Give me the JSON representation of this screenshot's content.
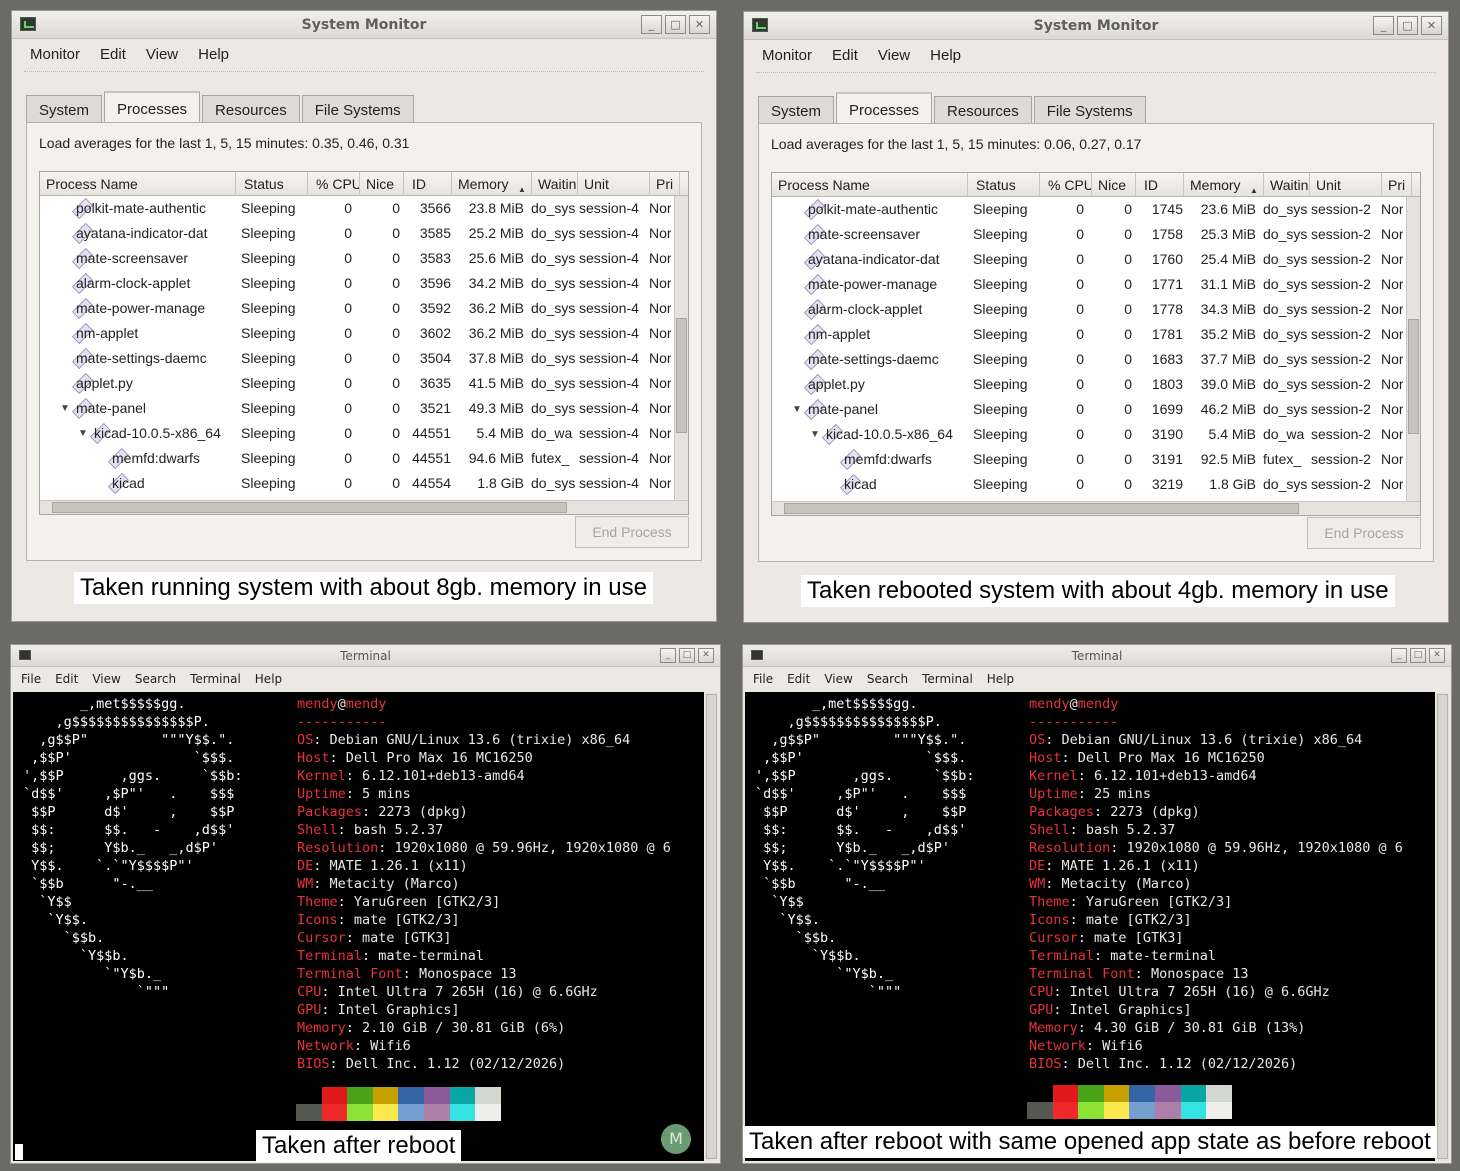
{
  "colors": {
    "key": "#e5333a",
    "frame": "#6a6a66"
  },
  "panels": [
    {
      "title": "System Monitor",
      "menu": [
        "Monitor",
        "Edit",
        "View",
        "Help"
      ],
      "tabs": [
        "System",
        "Processes",
        "Resources",
        "File Systems"
      ],
      "active_tab": "Processes",
      "load_avg": "Load averages for the last 1, 5, 15 minutes: 0.35, 0.46, 0.31",
      "columns": [
        "Process Name",
        "Status",
        "% CPU",
        "Nice",
        "ID",
        "Memory",
        "Waitin",
        "Unit",
        "Pri"
      ],
      "rows": [
        {
          "name": "polkit-mate-authentic",
          "status": "Sleeping",
          "cpu": "0",
          "nice": "0",
          "id": "3566",
          "mem": "23.8 MiB",
          "wait": "do_sys",
          "unit": "session-4",
          "pri": "Nor",
          "indent": 2,
          "icon": "diamond-icon"
        },
        {
          "name": "ayatana-indicator-dat",
          "status": "Sleeping",
          "cpu": "0",
          "nice": "0",
          "id": "3585",
          "mem": "25.2 MiB",
          "wait": "do_sys",
          "unit": "session-4",
          "pri": "Nor",
          "indent": 2,
          "icon": "diamond-icon"
        },
        {
          "name": "mate-screensaver",
          "status": "Sleeping",
          "cpu": "0",
          "nice": "0",
          "id": "3583",
          "mem": "25.6 MiB",
          "wait": "do_sys",
          "unit": "session-4",
          "pri": "Nor",
          "indent": 2,
          "icon": "diamond-icon"
        },
        {
          "name": "alarm-clock-applet",
          "status": "Sleeping",
          "cpu": "0",
          "nice": "0",
          "id": "3596",
          "mem": "34.2 MiB",
          "wait": "do_sys",
          "unit": "session-4",
          "pri": "Nor",
          "indent": 2,
          "icon": "alarm-clock-icon"
        },
        {
          "name": "mate-power-manage",
          "status": "Sleeping",
          "cpu": "0",
          "nice": "0",
          "id": "3592",
          "mem": "36.2 MiB",
          "wait": "do_sys",
          "unit": "session-4",
          "pri": "Nor",
          "indent": 2,
          "icon": "power-manager-icon"
        },
        {
          "name": "nm-applet",
          "status": "Sleeping",
          "cpu": "0",
          "nice": "0",
          "id": "3602",
          "mem": "36.2 MiB",
          "wait": "do_sys",
          "unit": "session-4",
          "pri": "Nor",
          "indent": 2,
          "icon": "network-icon"
        },
        {
          "name": "mate-settings-daemc",
          "status": "Sleeping",
          "cpu": "0",
          "nice": "0",
          "id": "3504",
          "mem": "37.8 MiB",
          "wait": "do_sys",
          "unit": "session-4",
          "pri": "Nor",
          "indent": 2,
          "icon": "diamond-icon"
        },
        {
          "name": "applet.py",
          "status": "Sleeping",
          "cpu": "0",
          "nice": "0",
          "id": "3635",
          "mem": "41.5 MiB",
          "wait": "do_sys",
          "unit": "session-4",
          "pri": "Nor",
          "indent": 2,
          "icon": "diamond-icon"
        },
        {
          "name": "mate-panel",
          "status": "Sleeping",
          "cpu": "0",
          "nice": "0",
          "id": "3521",
          "mem": "49.3 MiB",
          "wait": "do_sys",
          "unit": "session-4",
          "pri": "Nor",
          "indent": 2,
          "icon": "panel-icon",
          "expander": true
        },
        {
          "name": "kicad-10.0.5-x86_64",
          "status": "Sleeping",
          "cpu": "0",
          "nice": "0",
          "id": "44551",
          "mem": "5.4 MiB",
          "wait": "do_wa",
          "unit": "session-4",
          "pri": "Nor",
          "indent": 3,
          "icon": "diamond-icon",
          "expander": true
        },
        {
          "name": "memfd:dwarfs",
          "status": "Sleeping",
          "cpu": "0",
          "nice": "0",
          "id": "44551",
          "mem": "94.6 MiB",
          "wait": "futex_",
          "unit": "session-4",
          "pri": "Nor",
          "indent": 4,
          "icon": "diamond-icon"
        },
        {
          "name": "kicad",
          "status": "Sleeping",
          "cpu": "0",
          "nice": "0",
          "id": "44554",
          "mem": "1.8 GiB",
          "wait": "do_sys",
          "unit": "session-4",
          "pri": "Nor",
          "indent": 4,
          "icon": "diamond-icon"
        }
      ],
      "end_process": "End Process",
      "caption": "Taken running system with about 8gb. memory in use"
    },
    {
      "title": "System Monitor",
      "menu": [
        "Monitor",
        "Edit",
        "View",
        "Help"
      ],
      "tabs": [
        "System",
        "Processes",
        "Resources",
        "File Systems"
      ],
      "active_tab": "Processes",
      "load_avg": "Load averages for the last 1, 5, 15 minutes: 0.06, 0.27, 0.17",
      "columns": [
        "Process Name",
        "Status",
        "% CPU",
        "Nice",
        "ID",
        "Memory",
        "Waitin",
        "Unit",
        "Pri"
      ],
      "rows": [
        {
          "name": "polkit-mate-authentic",
          "status": "Sleeping",
          "cpu": "0",
          "nice": "0",
          "id": "1745",
          "mem": "23.6 MiB",
          "wait": "do_sys",
          "unit": "session-2",
          "pri": "Nor",
          "indent": 2,
          "icon": "diamond-icon"
        },
        {
          "name": "mate-screensaver",
          "status": "Sleeping",
          "cpu": "0",
          "nice": "0",
          "id": "1758",
          "mem": "25.3 MiB",
          "wait": "do_sys",
          "unit": "session-2",
          "pri": "Nor",
          "indent": 2,
          "icon": "diamond-icon"
        },
        {
          "name": "ayatana-indicator-dat",
          "status": "Sleeping",
          "cpu": "0",
          "nice": "0",
          "id": "1760",
          "mem": "25.4 MiB",
          "wait": "do_sys",
          "unit": "session-2",
          "pri": "Nor",
          "indent": 2,
          "icon": "diamond-icon"
        },
        {
          "name": "mate-power-manage",
          "status": "Sleeping",
          "cpu": "0",
          "nice": "0",
          "id": "1771",
          "mem": "31.1 MiB",
          "wait": "do_sys",
          "unit": "session-2",
          "pri": "Nor",
          "indent": 2,
          "icon": "power-manager-icon"
        },
        {
          "name": "alarm-clock-applet",
          "status": "Sleeping",
          "cpu": "0",
          "nice": "0",
          "id": "1778",
          "mem": "34.3 MiB",
          "wait": "do_sys",
          "unit": "session-2",
          "pri": "Nor",
          "indent": 2,
          "icon": "alarm-clock-icon"
        },
        {
          "name": "nm-applet",
          "status": "Sleeping",
          "cpu": "0",
          "nice": "0",
          "id": "1781",
          "mem": "35.2 MiB",
          "wait": "do_sys",
          "unit": "session-2",
          "pri": "Nor",
          "indent": 2,
          "icon": "network-icon"
        },
        {
          "name": "mate-settings-daemc",
          "status": "Sleeping",
          "cpu": "0",
          "nice": "0",
          "id": "1683",
          "mem": "37.7 MiB",
          "wait": "do_sys",
          "unit": "session-2",
          "pri": "Nor",
          "indent": 2,
          "icon": "diamond-icon"
        },
        {
          "name": "applet.py",
          "status": "Sleeping",
          "cpu": "0",
          "nice": "0",
          "id": "1803",
          "mem": "39.0 MiB",
          "wait": "do_sys",
          "unit": "session-2",
          "pri": "Nor",
          "indent": 2,
          "icon": "diamond-icon"
        },
        {
          "name": "mate-panel",
          "status": "Sleeping",
          "cpu": "0",
          "nice": "0",
          "id": "1699",
          "mem": "46.2 MiB",
          "wait": "do_sys",
          "unit": "session-2",
          "pri": "Nor",
          "indent": 2,
          "icon": "panel-icon",
          "expander": true
        },
        {
          "name": "kicad-10.0.5-x86_64",
          "status": "Sleeping",
          "cpu": "0",
          "nice": "0",
          "id": "3190",
          "mem": "5.4 MiB",
          "wait": "do_wa",
          "unit": "session-2",
          "pri": "Nor",
          "indent": 3,
          "icon": "diamond-icon",
          "expander": true
        },
        {
          "name": "memfd:dwarfs",
          "status": "Sleeping",
          "cpu": "0",
          "nice": "0",
          "id": "3191",
          "mem": "92.5 MiB",
          "wait": "futex_",
          "unit": "session-2",
          "pri": "Nor",
          "indent": 4,
          "icon": "diamond-icon"
        },
        {
          "name": "kicad",
          "status": "Sleeping",
          "cpu": "0",
          "nice": "0",
          "id": "3219",
          "mem": "1.8 GiB",
          "wait": "do_sys",
          "unit": "session-2",
          "pri": "Nor",
          "indent": 4,
          "icon": "diamond-icon"
        }
      ],
      "end_process": "End Process",
      "caption": "Taken rebooted system with about 4gb. memory in use"
    }
  ],
  "terminals": [
    {
      "title": "Terminal",
      "menu": [
        "File",
        "Edit",
        "View",
        "Search",
        "Terminal",
        "Help"
      ],
      "user": "mendy",
      "at": "@",
      "host": "mendy",
      "separator": "-----------",
      "info": [
        {
          "k": "OS",
          "v": "Debian GNU/Linux 13.6 (trixie) x86_64"
        },
        {
          "k": "Host",
          "v": "Dell Pro Max 16 MC16250"
        },
        {
          "k": "Kernel",
          "v": "6.12.101+deb13-amd64"
        },
        {
          "k": "Uptime",
          "v": "5 mins"
        },
        {
          "k": "Packages",
          "v": "2273 (dpkg)"
        },
        {
          "k": "Shell",
          "v": "bash 5.2.37"
        },
        {
          "k": "Resolution",
          "v": "1920x1080 @ 59.96Hz, 1920x1080 @ 6"
        },
        {
          "k": "DE",
          "v": "MATE 1.26.1 (x11)"
        },
        {
          "k": "WM",
          "v": "Metacity (Marco)"
        },
        {
          "k": "Theme",
          "v": "YaruGreen [GTK2/3]"
        },
        {
          "k": "Icons",
          "v": "mate [GTK2/3]"
        },
        {
          "k": "Cursor",
          "v": "mate [GTK3]"
        },
        {
          "k": "Terminal",
          "v": "mate-terminal"
        },
        {
          "k": "Terminal Font",
          "v": "Monospace 13"
        },
        {
          "k": "CPU",
          "v": "Intel Ultra 7 265H (16) @ 6.6GHz"
        },
        {
          "k": "GPU",
          "v": "Intel Graphics]"
        },
        {
          "k": "Memory",
          "v": "2.10 GiB / 30.81 GiB (6%)"
        },
        {
          "k": "Network",
          "v": "Wifi6"
        },
        {
          "k": "BIOS",
          "v": "Dell Inc. 1.12 (02/12/2026)"
        }
      ],
      "logo": [
        "       _,met$$$$$gg.",
        "    ,g$$$$$$$$$$$$$$$P.",
        "  ,g$$P\"         \"\"\"Y$$.\".",
        " ,$$P'               `$$$.",
        "',$$P       ,ggs.     `$$b:",
        "`d$$'     ,$P\"'   .    $$$",
        " $$P      d$'     ,    $$P",
        " $$:      $$.   -    ,d$$'",
        " $$;      Y$b._   _,d$P'",
        " Y$$.    `.`\"Y$$$$P\"'",
        " `$$b      \"-.__",
        "  `Y$$",
        "   `Y$$.",
        "     `$$b.",
        "       `Y$$b.",
        "          `\"Y$b._",
        "              `\"\"\""
      ],
      "caption": "Taken after reboot",
      "avatar": "M"
    },
    {
      "title": "Terminal",
      "menu": [
        "File",
        "Edit",
        "View",
        "Search",
        "Terminal",
        "Help"
      ],
      "user": "mendy",
      "at": "@",
      "host": "mendy",
      "separator": "-----------",
      "info": [
        {
          "k": "OS",
          "v": "Debian GNU/Linux 13.6 (trixie) x86_64"
        },
        {
          "k": "Host",
          "v": "Dell Pro Max 16 MC16250"
        },
        {
          "k": "Kernel",
          "v": "6.12.101+deb13-amd64"
        },
        {
          "k": "Uptime",
          "v": "25 mins"
        },
        {
          "k": "Packages",
          "v": "2273 (dpkg)"
        },
        {
          "k": "Shell",
          "v": "bash 5.2.37"
        },
        {
          "k": "Resolution",
          "v": "1920x1080 @ 59.96Hz, 1920x1080 @ 6"
        },
        {
          "k": "DE",
          "v": "MATE 1.26.1 (x11)"
        },
        {
          "k": "WM",
          "v": "Metacity (Marco)"
        },
        {
          "k": "Theme",
          "v": "YaruGreen [GTK2/3]"
        },
        {
          "k": "Icons",
          "v": "mate [GTK2/3]"
        },
        {
          "k": "Cursor",
          "v": "mate [GTK3]"
        },
        {
          "k": "Terminal",
          "v": "mate-terminal"
        },
        {
          "k": "Terminal Font",
          "v": "Monospace 13"
        },
        {
          "k": "CPU",
          "v": "Intel Ultra 7 265H (16) @ 6.6GHz"
        },
        {
          "k": "GPU",
          "v": "Intel Graphics]"
        },
        {
          "k": "Memory",
          "v": "4.30 GiB / 30.81 GiB (13%)"
        },
        {
          "k": "Network",
          "v": "Wifi6"
        },
        {
          "k": "BIOS",
          "v": "Dell Inc. 1.12 (02/12/2026)"
        }
      ],
      "logo": [
        "       _,met$$$$$gg.",
        "    ,g$$$$$$$$$$$$$$$P.",
        "  ,g$$P\"         \"\"\"Y$$.\".",
        " ,$$P'               `$$$.",
        "',$$P       ,ggs.     `$$b:",
        "`d$$'     ,$P\"'   .    $$$",
        " $$P      d$'     ,    $$P",
        " $$:      $$.   -    ,d$$'",
        " $$;      Y$b._   _,d$P'",
        " Y$$.    `.`\"Y$$$$P\"'",
        " `$$b      \"-.__",
        "  `Y$$",
        "   `Y$$.",
        "     `$$b.",
        "       `Y$$b.",
        "          `\"Y$b._",
        "              `\"\"\""
      ],
      "caption": "Taken after reboot with same opened app state as before reboot"
    }
  ],
  "palette": {
    "dark": [
      "#000000",
      "#e0191b",
      "#4aa318",
      "#c8a000",
      "#3465a4",
      "#8a5a9a",
      "#0aa5a5",
      "#d3d7cf"
    ],
    "bright": [
      "#555753",
      "#ef2929",
      "#8ae234",
      "#fce94f",
      "#729fcf",
      "#ad7fa8",
      "#34e2e2",
      "#eeeeec"
    ]
  }
}
